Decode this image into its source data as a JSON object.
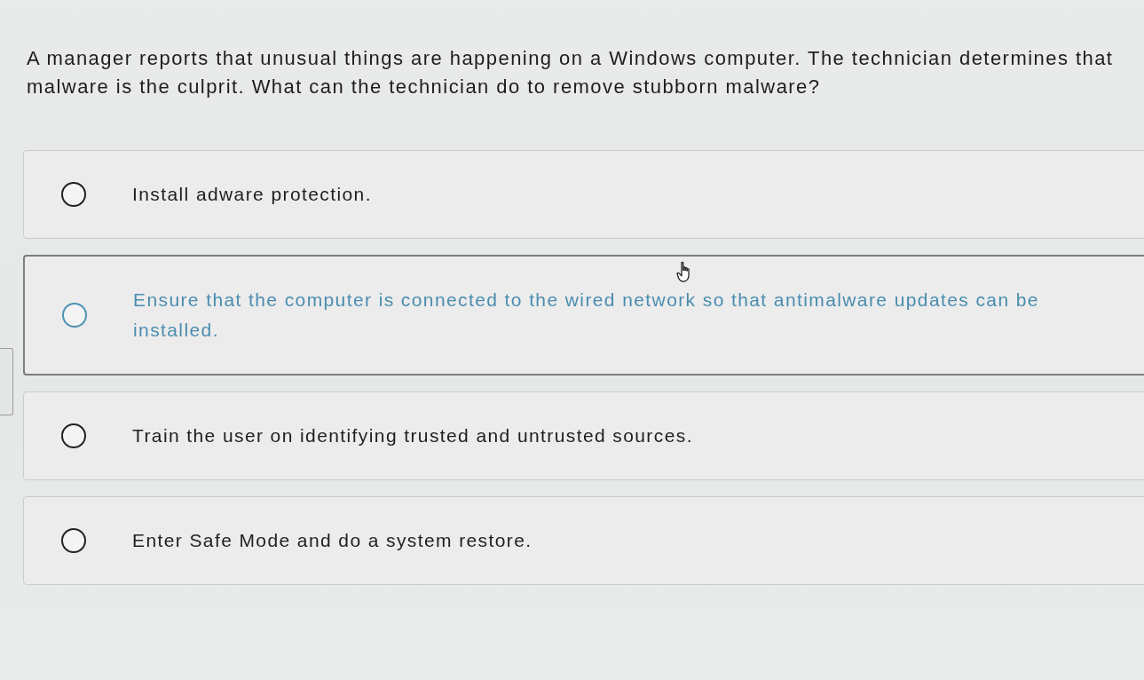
{
  "question": {
    "text": "A manager reports that unusual things are happening on a Windows computer. The technician determines that malware is the culprit. What can the technician do to remove stubborn malware?"
  },
  "options": [
    {
      "label": "Install adware protection.",
      "selected": false,
      "hovered": false
    },
    {
      "label": "Ensure that the computer is connected to the wired network so that antimalware updates can be installed.",
      "selected": false,
      "hovered": true
    },
    {
      "label": "Train the user on identifying trusted and untrusted sources.",
      "selected": false,
      "hovered": false
    },
    {
      "label": "Enter Safe Mode and do a system restore.",
      "selected": false,
      "hovered": false
    }
  ]
}
